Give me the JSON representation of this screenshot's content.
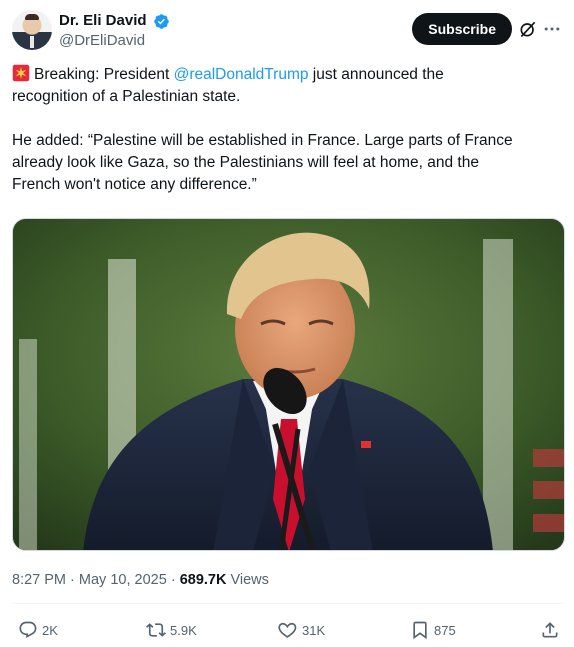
{
  "author": {
    "display_name": "Dr. Eli David",
    "handle": "@DrEliDavid",
    "verified": true,
    "verified_color": "#1d9bf0"
  },
  "header": {
    "subscribe_label": "Subscribe",
    "icons": [
      "grok-icon",
      "more-icon"
    ]
  },
  "tweet": {
    "emoji": "siren-icon",
    "line1_prefix": "Breaking: President ",
    "mention": "@realDonaldTrump",
    "line1_suffix": " just announced the",
    "line2": "recognition of a Palestinian state.",
    "quote_line1": "He added: “Palestine will be established in France. Large parts of France",
    "quote_line2": "already look like Gaza, so the Palestinians will feel at home, and the",
    "quote_line3": "French won't notice any difference.”"
  },
  "media": {
    "description_icon": "photo"
  },
  "meta": {
    "time": "8:27 PM",
    "separator": "·",
    "date": "May 10, 2025",
    "views_count": "689.7K",
    "views_label": "Views"
  },
  "actions": {
    "replies": "2K",
    "reposts": "5.9K",
    "likes": "31K",
    "bookmarks": "875"
  },
  "colors": {
    "accent": "#1d9bf0",
    "text": "#0f1419",
    "secondary": "#536471"
  }
}
